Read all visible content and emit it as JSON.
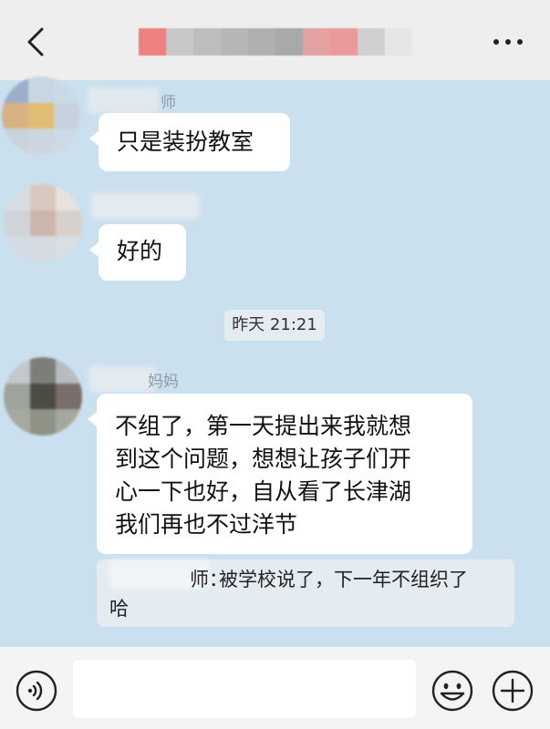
{
  "header": {
    "back_icon": "chevron-left-icon",
    "more_icon": "more-horizontal-icon",
    "title_blur_colors": [
      "#ee8080",
      "#c8c8c8",
      "#bdbdbd",
      "#b6b6b6",
      "#b0b0b0",
      "#a9a9a9",
      "#e3a2a2",
      "#ea9a9a",
      "#d0d0d0",
      "#e6e6e6"
    ]
  },
  "messages": {
    "m1": {
      "name_tail": "师",
      "text": "只是装扮教室",
      "avatar_colors": [
        "#9ab0c8",
        "#c8d6e2",
        "#cad9e6",
        "#d8b283",
        "#e0bd72",
        "#c7d2de",
        "#cad3dd",
        "#cdd6e0",
        "#cdd9e4"
      ]
    },
    "m2": {
      "text": "好的",
      "avatar_colors": [
        "#d8dde2",
        "#d8c9c0",
        "#e6e2de",
        "#d0d4d8",
        "#cdb5ac",
        "#d7d1cd",
        "#d3dbe2",
        "#d4dbe0",
        "#d7dee4"
      ]
    },
    "timestamp": "昨天 21:21",
    "m3": {
      "name_tail": "妈妈",
      "lines": [
        "不组了，第一天提出来我就想",
        "到这个问题，想想让孩子们开",
        "心一下也好，自从看了长津湖",
        "我们再也不过洋节"
      ],
      "avatar_colors": [
        "#c2c8cc",
        "#7c7e7a",
        "#b6bcbf",
        "#9ea49c",
        "#4b4c42",
        "#796e69",
        "#a6a9a0",
        "#8f9386",
        "#a4a89d"
      ]
    },
    "quote": {
      "name_tail": "师：",
      "line1": "被学校说了，下一年不组织了",
      "line2": "哈"
    }
  },
  "inputbar": {
    "voice_icon": "voice-icon",
    "input_value": "",
    "emoji_icon": "smiley-face-icon",
    "plus_icon": "plus-circle-icon"
  }
}
